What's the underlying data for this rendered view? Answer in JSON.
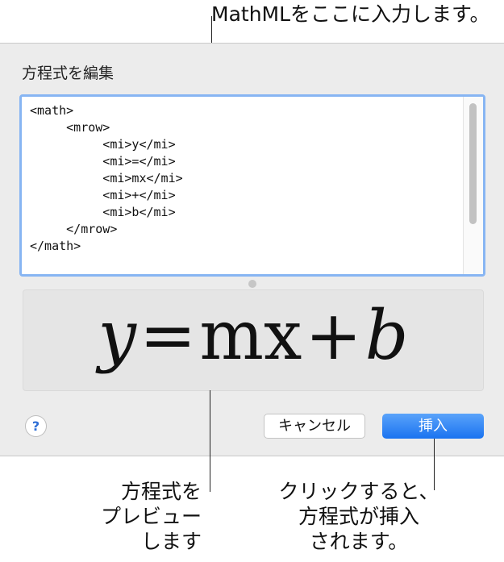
{
  "callouts": {
    "top": "MathMLをここに入力します。",
    "left_lines": [
      "方程式を",
      "プレビュー",
      "します"
    ],
    "right_lines": [
      "クリックすると、",
      "方程式が挿入",
      "されます。"
    ]
  },
  "dialog": {
    "title": "方程式を編集",
    "code_lines": [
      "<math>",
      "     <mrow>",
      "          <mi>y</mi>",
      "          <mi>=</mi>",
      "          <mi>mx</mi>",
      "          <mi>+</mi>",
      "          <mi>b</mi>",
      "     </mrow>",
      "</math>"
    ],
    "preview": {
      "y": "y",
      "eq": "=",
      "mx": "mx",
      "plus": "+",
      "b": "b"
    },
    "help_label": "?",
    "cancel_label": "キャンセル",
    "insert_label": "挿入"
  }
}
